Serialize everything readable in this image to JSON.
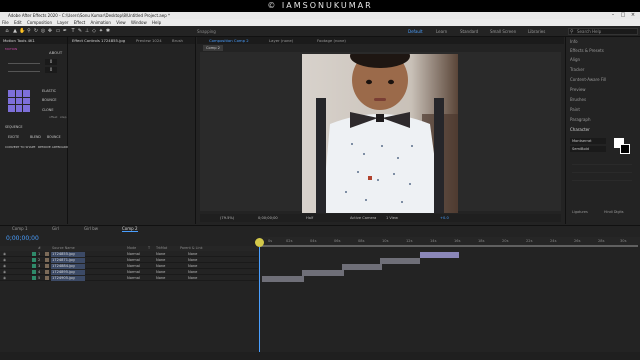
{
  "watermark": "© IAMSONUKUMAR",
  "window": {
    "title": "Adobe After Effects 2020 - C:\\Users\\Sonu Kumar\\Desktop\\8\\Untitled Project.aep *"
  },
  "menu": [
    "File",
    "Edit",
    "Composition",
    "Layer",
    "Effect",
    "Animation",
    "View",
    "Window",
    "Help"
  ],
  "toolbar": {
    "snapping_label": "Snapping",
    "workspaces": [
      "Default",
      "Learn",
      "Standard",
      "Small Screen",
      "Libraries"
    ],
    "active_workspace": "Default",
    "search_placeholder": "Search Help"
  },
  "left_panel": {
    "tabs": [
      "Motion Tools 4K1"
    ],
    "about_label": "ABOUT",
    "motion_label": "MOTION",
    "items": [
      "ELASTIC",
      "BOUNCE",
      "CLONE",
      "offset",
      "step",
      "SEQUENCE",
      "EXCITE",
      "BLEND",
      "BOUNCE",
      "ANCHOR",
      "WARP",
      "CONVERT TO SHAPE",
      "REMOVE ARTBOARD"
    ],
    "stepper_values": [
      "0",
      "0"
    ]
  },
  "effect_panel": {
    "tabs": [
      "Effect Controls 1724855.jpg",
      "Preview 1024",
      "Brush"
    ]
  },
  "comp_panel": {
    "tabs": [
      "Composition Comp 2",
      "Layer (none)",
      "Footage (none)"
    ],
    "subtab": "Comp 2",
    "zoom": "(79.5%)",
    "timecode": "0;00;00;00",
    "resolution": "Half",
    "camera": "Active Camera",
    "views": "1 View",
    "exposure": "+0.0"
  },
  "right_panel": {
    "items": [
      "Info",
      "Effects & Presets",
      "Align",
      "Tracker",
      "Content-Aware Fill",
      "Preview",
      "Brushes",
      "Paint",
      "Paragraph",
      "Character"
    ],
    "font_name": "Montserrat",
    "font_style": "SemiBold",
    "ligatures": "Ligatures",
    "hindi_digits": "Hindi Digits"
  },
  "timeline": {
    "tabs": [
      "Comp 1",
      "Girl",
      "Girl bw",
      "Comp 2"
    ],
    "active_tab": "Comp 2",
    "timecode": "0;00;00;00",
    "columns": [
      "#",
      "Source Name",
      "Mode",
      "T",
      "TrkMat",
      "Parent & Link"
    ],
    "layers": [
      {
        "num": "1",
        "name": "1724855.jpg",
        "mode": "Normal",
        "trkmat": "None",
        "parent": "None"
      },
      {
        "num": "2",
        "name": "1724871.jpg",
        "mode": "Normal",
        "trkmat": "None",
        "parent": "None"
      },
      {
        "num": "3",
        "name": "1724884.jpg",
        "mode": "Normal",
        "trkmat": "None",
        "parent": "None"
      },
      {
        "num": "4",
        "name": "1724895.jpg",
        "mode": "Normal",
        "trkmat": "None",
        "parent": "None"
      },
      {
        "num": "5",
        "name": "1724905.jpg",
        "mode": "Normal",
        "trkmat": "None",
        "parent": "None"
      }
    ],
    "ruler_ticks": [
      "0s",
      "02s",
      "04s",
      "06s",
      "08s",
      "10s",
      "12s",
      "14s",
      "16s",
      "18s",
      "20s",
      "22s",
      "24s",
      "26s",
      "28s",
      "30s"
    ]
  },
  "colors": {
    "accent_blue": "#4a9fff",
    "playhead": "#d4c94a",
    "panel_bg": "#232323"
  }
}
